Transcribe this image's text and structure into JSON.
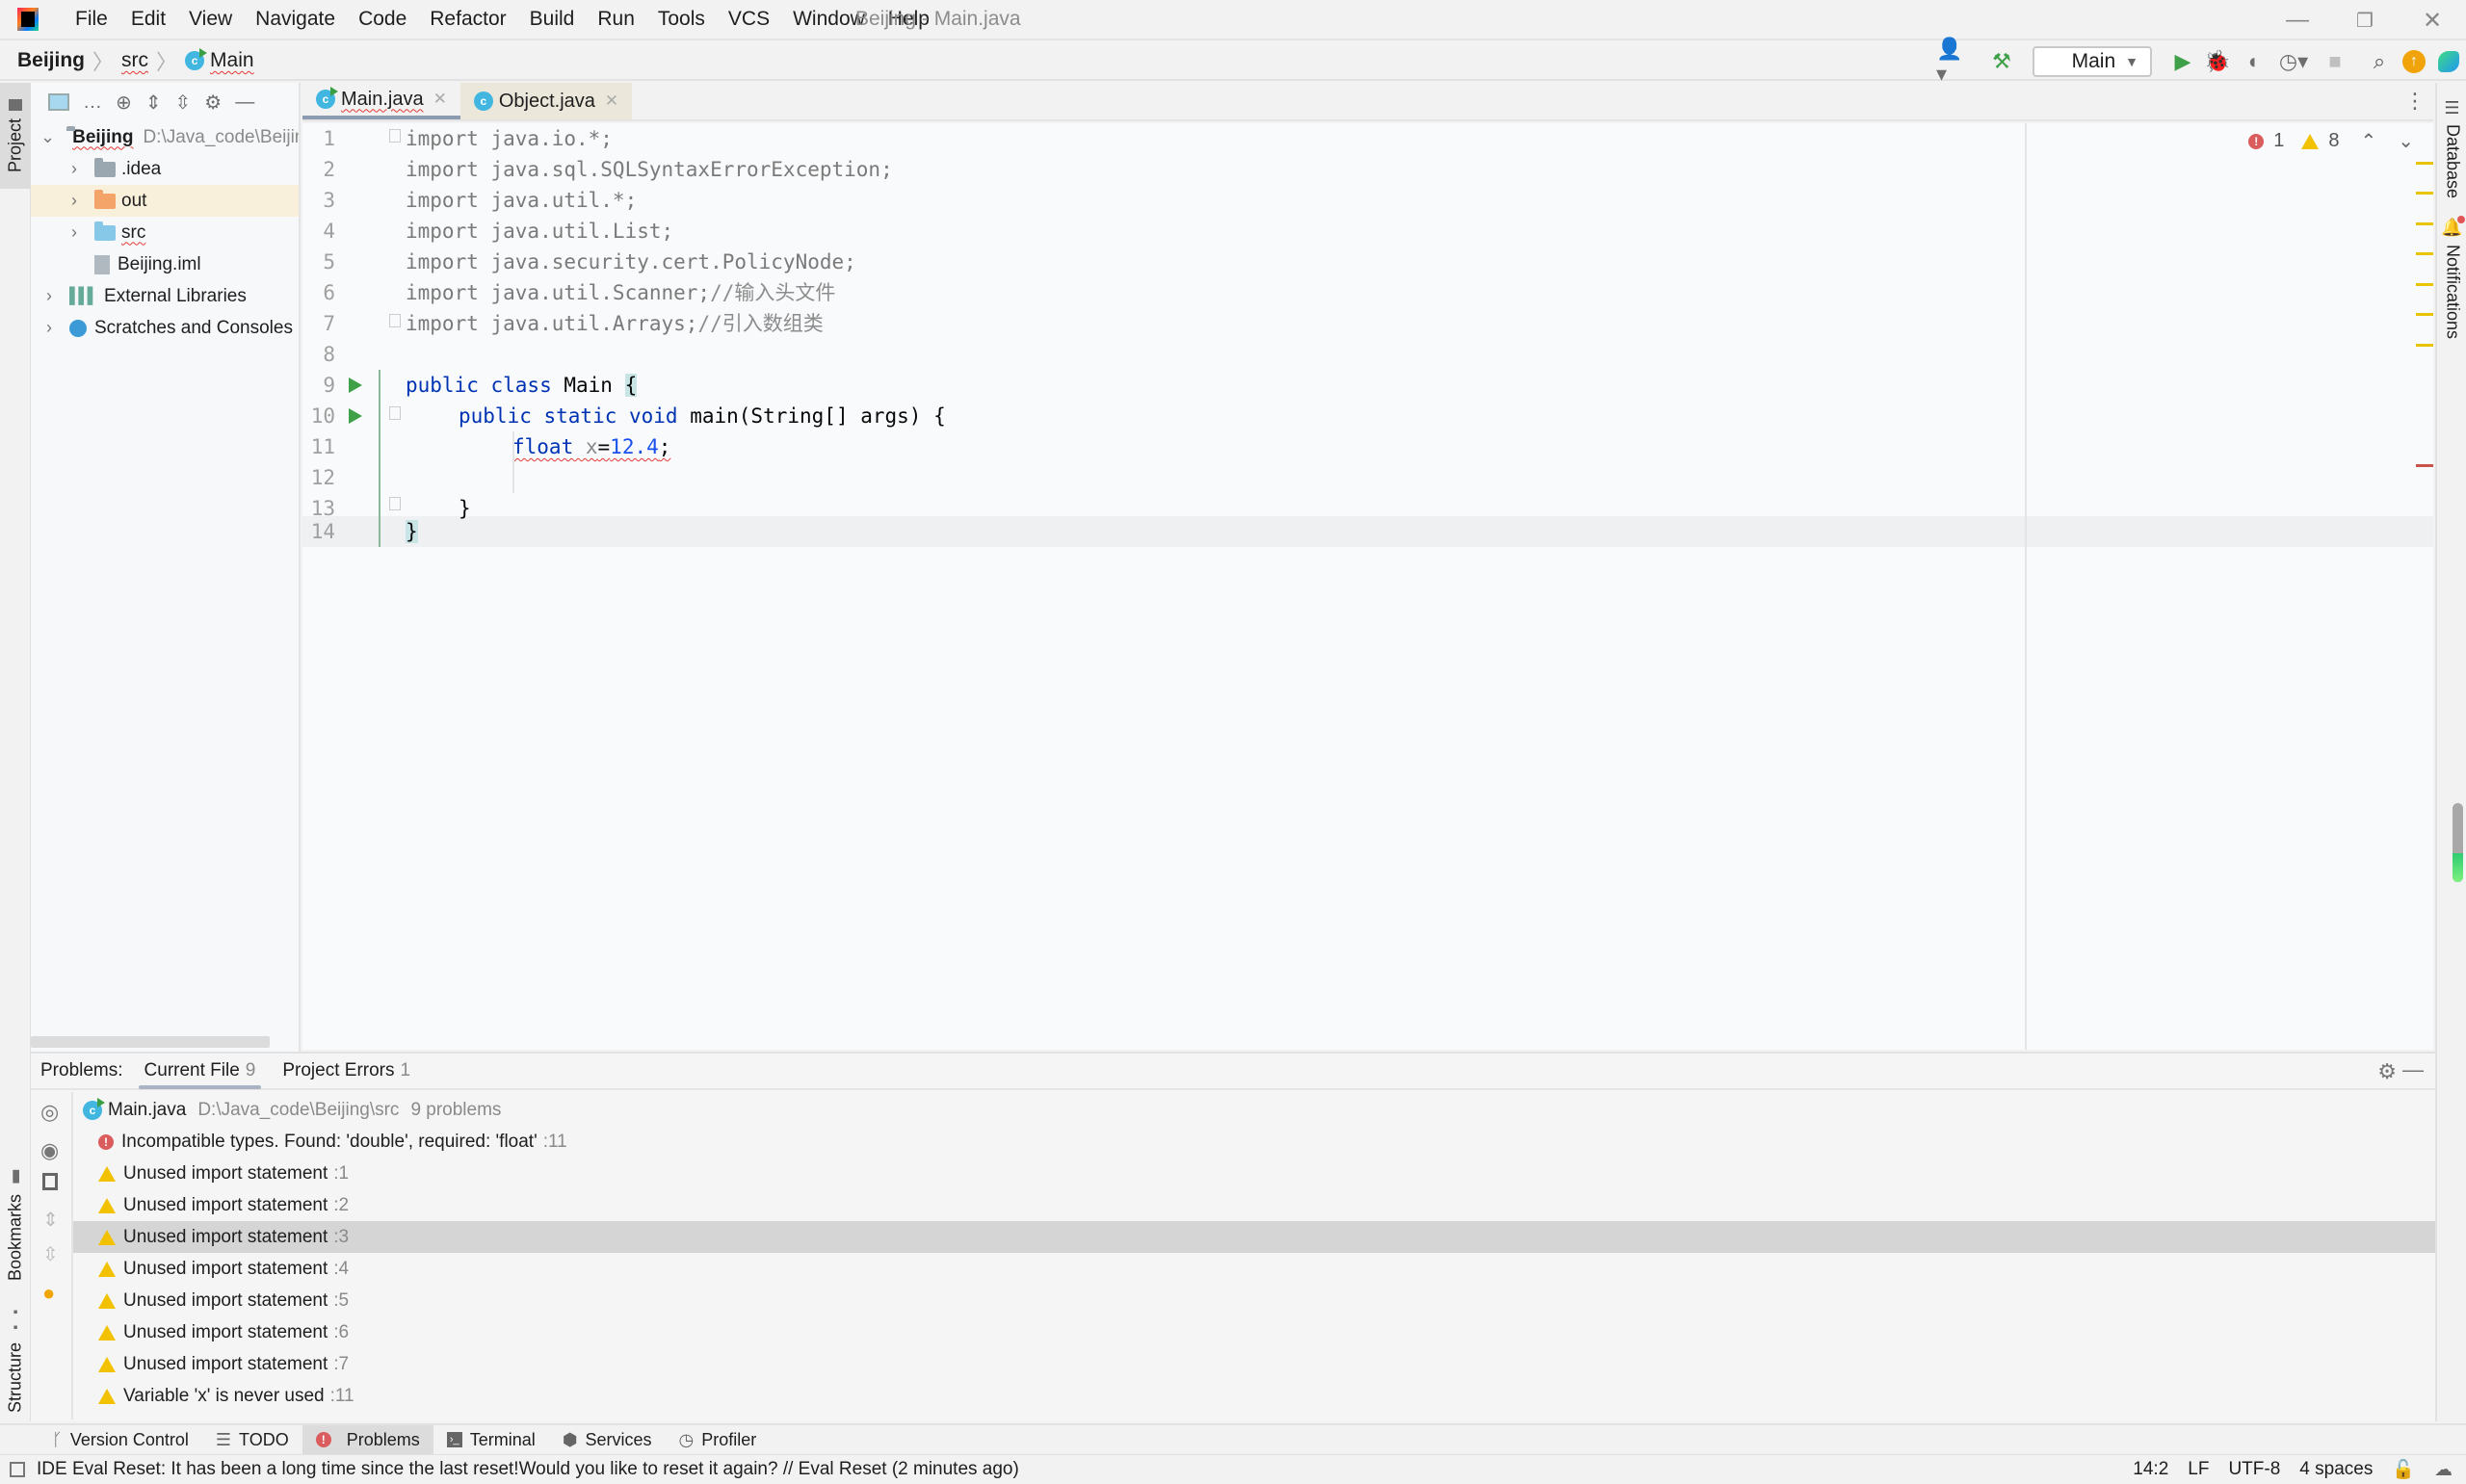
{
  "window": {
    "title": "Beijing - Main.java",
    "menu": [
      "File",
      "Edit",
      "View",
      "Navigate",
      "Code",
      "Refactor",
      "Build",
      "Run",
      "Tools",
      "VCS",
      "Window",
      "Help"
    ],
    "controls": {
      "minimize": "—",
      "restore": "❐",
      "close": "✕"
    }
  },
  "breadcrumb": {
    "project": "Beijing",
    "folder": "src",
    "file": "Main"
  },
  "toolbar": {
    "run_config": "Main",
    "icons": [
      "user-icon",
      "build-hammer-icon",
      "run-icon",
      "debug-icon",
      "coverage-icon",
      "profile-icon",
      "stop-icon",
      "search-icon",
      "update-icon",
      "toolbox-icon"
    ]
  },
  "project_panel": {
    "tab_label": "Project",
    "tree": [
      {
        "label": "Beijing",
        "detail": "D:\\Java_code\\Beijing",
        "level": 0,
        "expanded": true,
        "type": "module"
      },
      {
        "label": ".idea",
        "level": 1,
        "type": "folder-gray"
      },
      {
        "label": "out",
        "level": 1,
        "type": "folder-orange",
        "selected": true
      },
      {
        "label": "src",
        "level": 1,
        "type": "folder-blue"
      },
      {
        "label": "Beijing.iml",
        "level": 1,
        "type": "file"
      },
      {
        "label": "External Libraries",
        "level": 0,
        "type": "libraries"
      },
      {
        "label": "Scratches and Consoles",
        "level": 0,
        "type": "scratches"
      }
    ]
  },
  "editor_tabs": [
    {
      "label": "Main.java",
      "active": true
    },
    {
      "label": "Object.java",
      "active": false
    }
  ],
  "editor": {
    "line_numbers": [
      "1",
      "2",
      "3",
      "4",
      "5",
      "6",
      "7",
      "8",
      "9",
      "10",
      "11",
      "12",
      "13",
      "14"
    ],
    "lines": {
      "l1": "import java.io.*;",
      "l2": "import java.sql.SQLSyntaxErrorException;",
      "l3": "import java.util.*;",
      "l4": "import java.util.List;",
      "l5": "import java.security.cert.PolicyNode;",
      "l6a": "import java.util.Scanner;",
      "l6b": "//输入头文件",
      "l7a": "import java.util.Arrays;",
      "l7b": "//引入数组类",
      "l9kw": "public class",
      "l9name": " Main ",
      "l9brace": "{",
      "l10kw": "public static void",
      "l10rest": " main(String[] args) {",
      "l11kw": "float",
      "l11var": " x",
      "l11eq": "=",
      "l11num": "12.4",
      "l11semi": ";",
      "l13": "}",
      "l14": "}"
    },
    "error_count": "1",
    "warning_count": "8"
  },
  "right_strip": {
    "database": "Database",
    "notifications": "Notifications",
    "memory_fill_fraction": 0.37
  },
  "problems": {
    "label": "Problems:",
    "tabs": [
      {
        "label": "Current File",
        "count": "9"
      },
      {
        "label": "Project Errors",
        "count": "1"
      }
    ],
    "file": {
      "name": "Main.java",
      "path": "D:\\Java_code\\Beijing\\src",
      "summary": "9 problems"
    },
    "items": [
      {
        "severity": "error",
        "text": "Incompatible types. Found: 'double', required: 'float'",
        "line": ":11"
      },
      {
        "severity": "warning",
        "text": "Unused import statement",
        "line": ":1"
      },
      {
        "severity": "warning",
        "text": "Unused import statement",
        "line": ":2"
      },
      {
        "severity": "warning",
        "text": "Unused import statement",
        "line": ":3",
        "selected": true
      },
      {
        "severity": "warning",
        "text": "Unused import statement",
        "line": ":4"
      },
      {
        "severity": "warning",
        "text": "Unused import statement",
        "line": ":5"
      },
      {
        "severity": "warning",
        "text": "Unused import statement",
        "line": ":6"
      },
      {
        "severity": "warning",
        "text": "Unused import statement",
        "line": ":7"
      },
      {
        "severity": "warning",
        "text": "Variable 'x' is never used",
        "line": ":11"
      }
    ]
  },
  "left_strip": {
    "bookmarks": "Bookmarks",
    "structure": "Structure"
  },
  "tool_windows": [
    {
      "label": "Version Control"
    },
    {
      "label": "TODO"
    },
    {
      "label": "Problems",
      "active": true
    },
    {
      "label": "Terminal"
    },
    {
      "label": "Services"
    },
    {
      "label": "Profiler"
    }
  ],
  "status": {
    "message": "IDE Eval Reset: It has been a long time since the last reset!Would you like to reset it again? // Eval Reset (2 minutes ago)",
    "position": "14:2",
    "line_sep": "LF",
    "encoding": "UTF-8",
    "indent": "4 spaces"
  },
  "colors": {
    "error": "#db5c5c",
    "warning": "#f2c200",
    "run": "#3ea048",
    "keyword": "#0033b3",
    "number": "#1750eb"
  }
}
